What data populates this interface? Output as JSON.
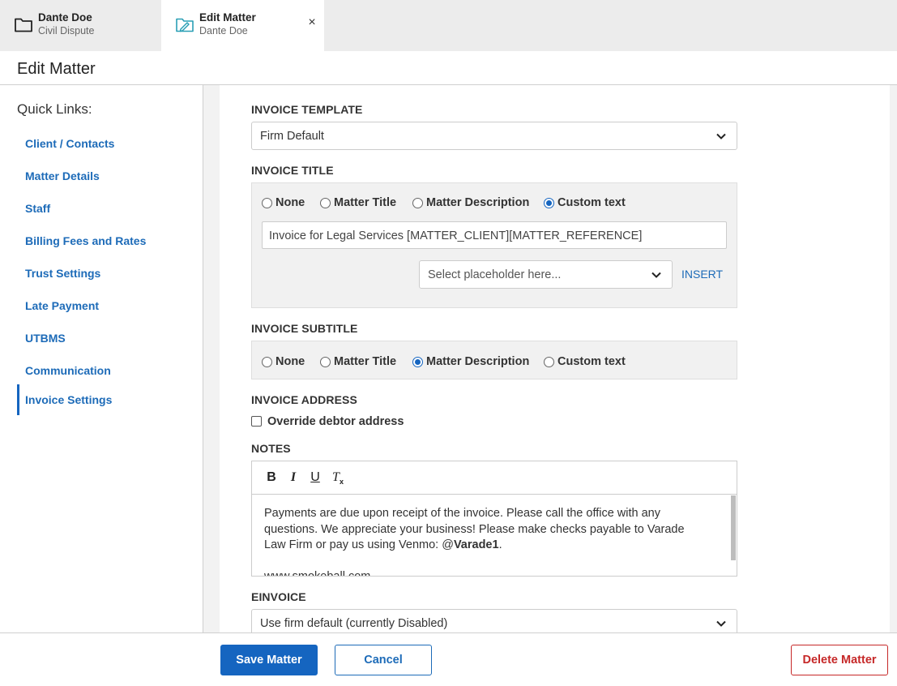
{
  "tabs": [
    {
      "title": "Dante Doe",
      "subtitle": "Civil Dispute",
      "icon": "folder-icon"
    },
    {
      "title": "Edit Matter",
      "subtitle": "Dante Doe",
      "icon": "folder-edit-icon",
      "close": "×"
    }
  ],
  "page": {
    "title": "Edit Matter"
  },
  "sidebar": {
    "title": "Quick Links:",
    "items": [
      {
        "label": "Client / Contacts"
      },
      {
        "label": "Matter Details"
      },
      {
        "label": "Staff"
      },
      {
        "label": "Billing Fees and Rates"
      },
      {
        "label": "Trust Settings"
      },
      {
        "label": "Late Payment"
      },
      {
        "label": "UTBMS"
      },
      {
        "label": "Communication"
      },
      {
        "label": "Invoice Settings",
        "active": true
      }
    ]
  },
  "invoice_template": {
    "label": "INVOICE TEMPLATE",
    "value": "Firm Default"
  },
  "invoice_title": {
    "label": "INVOICE TITLE",
    "options": [
      "None",
      "Matter Title",
      "Matter Description",
      "Custom text"
    ],
    "selected": "Custom text",
    "custom_value": "Invoice for Legal Services [MATTER_CLIENT][MATTER_REFERENCE]",
    "placeholder_select": "Select placeholder here...",
    "insert_label": "INSERT"
  },
  "invoice_subtitle": {
    "label": "INVOICE SUBTITLE",
    "options": [
      "None",
      "Matter Title",
      "Matter Description",
      "Custom text"
    ],
    "selected": "Matter Description"
  },
  "invoice_address": {
    "label": "INVOICE ADDRESS",
    "checkbox_label": "Override debtor address",
    "checked": false
  },
  "notes": {
    "label": "NOTES",
    "toolbar": {
      "bold": "B",
      "italic": "I",
      "underline": "U",
      "clear_format": "T"
    },
    "text_before": "Payments are due upon receipt of the invoice. Please call the office with any questions. We appreciate your business! Please make checks payable to Varade Law Firm or pay us using Venmo: @",
    "text_bold": "Varade1",
    "text_after": ".",
    "url_line": "www.smokeball.com"
  },
  "einvoice": {
    "label": "EINVOICE",
    "value": "Use firm default (currently Disabled)"
  },
  "footer": {
    "save": "Save Matter",
    "cancel": "Cancel",
    "delete": "Delete Matter"
  },
  "colors": {
    "accent": "#1565c0",
    "link": "#1d6bb8",
    "danger": "#c62828",
    "panel": "#f1f1f1"
  }
}
